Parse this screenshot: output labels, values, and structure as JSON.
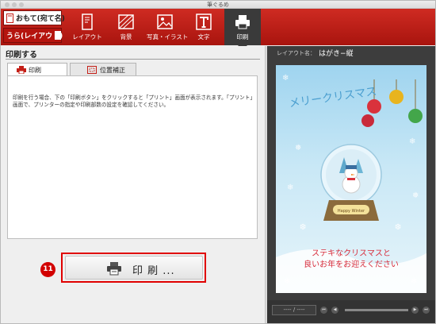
{
  "window": {
    "title": "筆ぐるめ"
  },
  "side_toggle": {
    "front": "おもて(宛て名)",
    "back": "うら(レイアウト)"
  },
  "toolbar": {
    "tools": [
      {
        "label": "レイアウト",
        "icon": "layout-icon"
      },
      {
        "label": "背景",
        "icon": "background-icon"
      },
      {
        "label": "写真・イラスト",
        "icon": "picture-icon"
      },
      {
        "label": "文字",
        "icon": "text-icon"
      },
      {
        "label": "印刷",
        "icon": "printer-icon",
        "active": true
      }
    ]
  },
  "panel": {
    "title": "印刷する",
    "tabs": [
      {
        "label": "印刷",
        "active": true
      },
      {
        "label": "位置補正",
        "active": false
      }
    ],
    "description": "印刷を行う場合、下の「印刷ボタン」をクリックすると「プリント」画面が表示されます。「プリント」画面で、プリンターの指定や印刷部数の設定を確認してください。",
    "print_button": "印 刷 ...",
    "callout": "11"
  },
  "preview": {
    "layout_label": "レイアウト名：",
    "layout_value": "はがき−縦",
    "card_title": "メリークリスマス",
    "globe_plate": "Happy Winter",
    "card_message_line1": "ステキなクリスマスと",
    "card_message_line2": "良いお年をお迎えください",
    "page_indicator": "---- / ----"
  },
  "colors": {
    "toolbar": "#c41f17",
    "highlight": "#e00000",
    "card_text": "#d72b3a"
  }
}
